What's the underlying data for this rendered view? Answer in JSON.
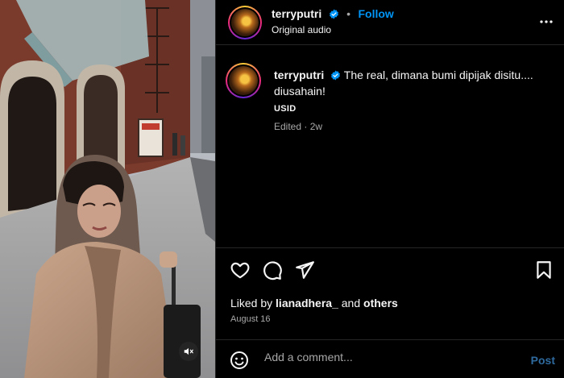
{
  "post": {
    "username": "terryputri",
    "follow_label": "Follow",
    "audio_label": "Original audio",
    "caption": "The real, dimana bumi dipijak disitu.... diusahain!",
    "caption_tag": "USID",
    "edited": "Edited",
    "age": "2w",
    "liked_by_prefix": "Liked by",
    "liked_by_user": "lianadhera_",
    "liked_by_and": "and",
    "liked_by_others": "others",
    "date": "August 16"
  },
  "comment": {
    "placeholder": "Add a comment...",
    "post_label": "Post"
  },
  "icons": {
    "verified": "verified-badge-icon",
    "more": "more-options-icon",
    "like": "heart-icon",
    "comment": "comment-bubble-icon",
    "share": "paper-plane-icon",
    "save": "bookmark-icon",
    "emoji": "emoji-icon",
    "mute": "speaker-muted-icon"
  },
  "colors": {
    "background": "#000000",
    "accent": "#0095f6",
    "muted_text": "#a8a8a8",
    "post_disabled": "#2e6a9e"
  }
}
